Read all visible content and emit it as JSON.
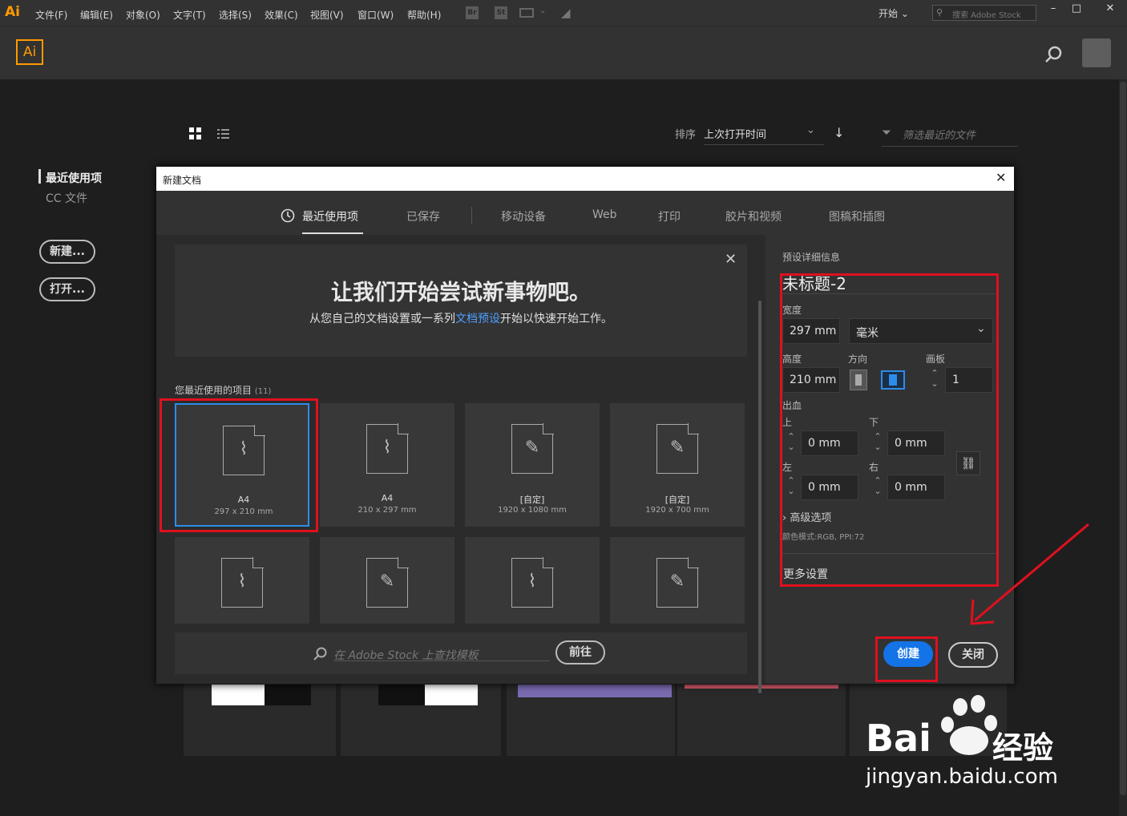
{
  "menubar": {
    "logo": "Ai",
    "items": [
      "文件(F)",
      "编辑(E)",
      "对象(O)",
      "文字(T)",
      "选择(S)",
      "效果(C)",
      "视图(V)",
      "窗口(W)",
      "帮助(H)"
    ],
    "icons": [
      "Br",
      "St"
    ],
    "workspace": "开始",
    "stock_search": "搜索 Adobe Stock"
  },
  "appbar": {
    "logo": "Ai"
  },
  "home": {
    "sort_label": "排序",
    "sort_value": "上次打开时间",
    "filter_placeholder": "筛选最近的文件",
    "nav": [
      "最近使用项",
      "CC 文件"
    ],
    "new_button": "新建...",
    "open_button": "打开..."
  },
  "dialog": {
    "title": "新建文档",
    "tabs": [
      "最近使用项",
      "已保存",
      "移动设备",
      "Web",
      "打印",
      "胶片和视频",
      "图稿和插图"
    ],
    "welcome_title": "让我们开始尝试新事物吧。",
    "welcome_sub_pre": "从您自己的文档设置或一系列",
    "welcome_sub_link": "文档预设",
    "welcome_sub_post": "开始以快速开始工作。",
    "recent_label": "您最近使用的项目",
    "recent_count": "(11)",
    "cards": [
      {
        "name": "A4",
        "dims": "297 x 210 mm"
      },
      {
        "name": "A4",
        "dims": "210 x 297 mm"
      },
      {
        "name": "[自定]",
        "dims": "1920 x 1080 mm"
      },
      {
        "name": "[自定]",
        "dims": "1920 x 700 mm"
      }
    ],
    "stock_placeholder": "在 Adobe Stock 上查找模板",
    "stock_go": "前往"
  },
  "preset": {
    "header": "预设详细信息",
    "doc_name": "未标题-2",
    "width_label": "宽度",
    "width": "297 mm",
    "unit": "毫米",
    "height_label": "高度",
    "height": "210 mm",
    "orientation_label": "方向",
    "artboards_label": "画板",
    "artboards": "1",
    "bleed_label": "出血",
    "top_label": "上",
    "top": "0 mm",
    "bottom_label": "下",
    "bottom": "0 mm",
    "left_label": "左",
    "left": "0 mm",
    "right_label": "右",
    "right": "0 mm",
    "advanced": "高级选项",
    "color_mode": "颜色模式:RGB, PPI:72",
    "more": "更多设置",
    "create": "创建",
    "close": "关闭"
  },
  "watermark": {
    "brand": "Bai",
    "brand2": "经验",
    "url": "jingyan.baidu.com"
  }
}
